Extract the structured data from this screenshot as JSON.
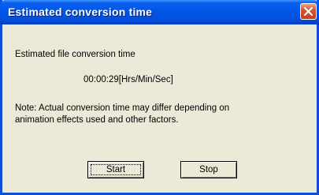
{
  "window": {
    "title": "Estimated conversion time"
  },
  "content": {
    "heading": "Estimated file conversion time",
    "time_value": "00:00:29",
    "time_unit": "[Hrs/Min/Sec]",
    "note_line1": "Note: Actual conversion time may differ depending on",
    "note_line2": "animation effects used and other factors."
  },
  "buttons": {
    "start_label": "Start",
    "stop_label": "Stop"
  },
  "colors": {
    "titlebar": "#0055e5",
    "close_button": "#d8552f",
    "dialog_background": "#ece9d8"
  },
  "icons": {
    "close": "close-icon"
  }
}
